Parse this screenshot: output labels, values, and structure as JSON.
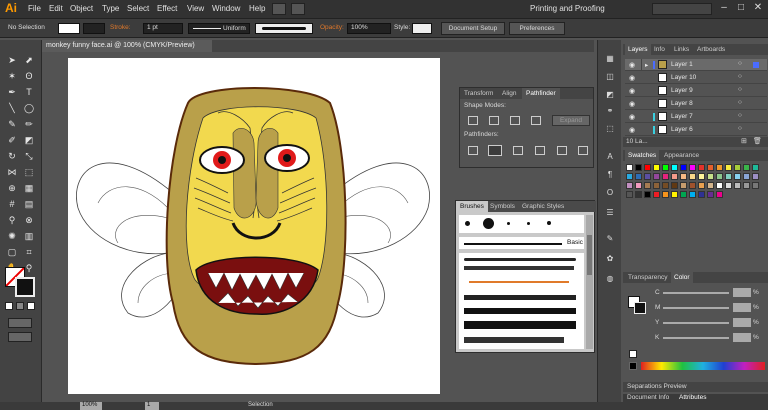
{
  "app": {
    "logo": "Ai"
  },
  "menu": [
    "File",
    "Edit",
    "Object",
    "Type",
    "Select",
    "Effect",
    "View",
    "Window",
    "Help"
  ],
  "workspace": "Printing and Proofing",
  "control": {
    "selection": "No Selection",
    "stroke_label": "Stroke:",
    "stroke_value": "1 pt",
    "uniform": "Uniform",
    "opacity_label": "Opacity:",
    "opacity_value": "100%",
    "style_label": "Style:",
    "doc_setup": "Document Setup",
    "preferences": "Preferences"
  },
  "document": {
    "tab": "monkey funny face.ai @ 100% (CMYK/Preview)"
  },
  "pathfinder": {
    "tabs": [
      "Transform",
      "Align",
      "Pathfinder"
    ],
    "shape_modes": "Shape Modes:",
    "expand": "Expand",
    "pathfinders": "Pathfinders:"
  },
  "brushes": {
    "tabs": [
      "Brushes",
      "Symbols",
      "Graphic Styles"
    ],
    "basic": "Basic"
  },
  "layers": {
    "tabs": [
      "Layers",
      "Info",
      "Links",
      "Artboards"
    ],
    "items": [
      {
        "name": "Layer 1",
        "color": "#4a6cff"
      },
      {
        "name": "Layer 10",
        "color": "#ffffff"
      },
      {
        "name": "Layer 9",
        "color": "#ffffff"
      },
      {
        "name": "Layer 8",
        "color": "#ffffff"
      },
      {
        "name": "Layer 7",
        "color": "#3ad0e0"
      },
      {
        "name": "Layer 6",
        "color": "#3ad0e0"
      }
    ],
    "footer": "10 La..."
  },
  "swatches": {
    "tabs": [
      "Swatches",
      "Appearance"
    ],
    "colors": [
      "#ffffff",
      "#000000",
      "#ff0000",
      "#ffff00",
      "#00ff00",
      "#00ffff",
      "#0000ff",
      "#ff00ff",
      "#e3322b",
      "#e55f2c",
      "#f19a2b",
      "#f7ec3d",
      "#a6cd39",
      "#3ab54a",
      "#1db999",
      "#28aae1",
      "#2d6db5",
      "#5a4fa2",
      "#93479b",
      "#e5237c",
      "#f79a8a",
      "#f7b983",
      "#fbd889",
      "#fff59b",
      "#c5df89",
      "#8cc68c",
      "#80cfbf",
      "#86d0f0",
      "#8aa5d6",
      "#9c8ec4",
      "#c28fc0",
      "#f29bbe",
      "#a67c52",
      "#8c6239",
      "#754c24",
      "#603913",
      "#c69c6d",
      "#a0522d",
      "#e8a050",
      "#d2b48c",
      "#ffffff",
      "#dddddd",
      "#bbbbbb",
      "#999999",
      "#777777",
      "#555555",
      "#333333",
      "#000000",
      "#ed1c24",
      "#f7941d",
      "#fff200",
      "#00a651",
      "#00aeef",
      "#2e3192",
      "#662d91",
      "#ec008c"
    ]
  },
  "transparency": {
    "tabs": [
      "Transparency",
      "Color"
    ],
    "channels": [
      "C",
      "M",
      "Y",
      "K"
    ],
    "percent": "%"
  },
  "separations": "Separations Preview",
  "bottom_tabs": [
    "Document Info",
    "Attributes"
  ],
  "status": {
    "zoom": "100%",
    "page": "1",
    "mode": "Selection"
  }
}
